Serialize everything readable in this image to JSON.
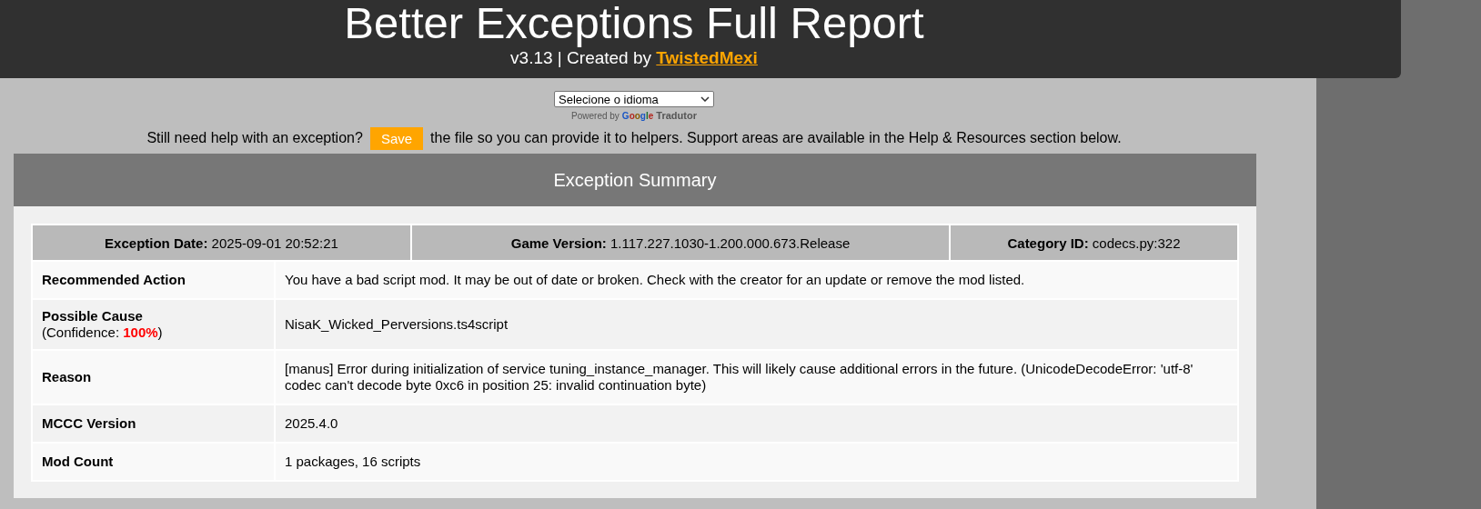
{
  "header": {
    "title": "Better Exceptions Full Report",
    "subtitle": "v3.13 | Created by",
    "author_link": "TwistedMexi"
  },
  "translate": {
    "select": "Selecione o idioma",
    "powered_by": "Powered by",
    "google": "Google",
    "service": "Tradutor"
  },
  "notice": {
    "before": "Still need help with an exception?",
    "button": "Save",
    "after": "the file so you can provide it to helpers. Support areas are available in the Help & Resources section below."
  },
  "summary": {
    "title": "Exception Summary",
    "facts": [
      {
        "label": "Exception Date:",
        "value": "2025-09-01 20:52:21"
      },
      {
        "label": "Game Version:",
        "value": "1.117.227.1030-1.200.000.673.Release"
      },
      {
        "label": "Category ID:",
        "value": "codecs.py:322"
      }
    ],
    "rows": [
      {
        "label": "Recommended Action",
        "value": "You have a bad script mod. It may be out of date or broken. Check with the creator for an update or remove the mod listed."
      },
      {
        "label": "Possible Cause",
        "note": "(Confidence: **100%**)",
        "value": "NisaK_Wicked_Perversions.ts4script"
      },
      {
        "label": "Reason",
        "value": "[manus] Error during initialization of service tuning_instance_manager. This will likely cause additional errors in the future. (UnicodeDecodeError: 'utf-8' codec can't decode byte 0xc6 in position 25: invalid continuation byte)"
      },
      {
        "label": "MCCC Version",
        "value": "2025.4.0"
      },
      {
        "label": "Mod Count",
        "value": "1 packages, 16 scripts"
      }
    ]
  }
}
